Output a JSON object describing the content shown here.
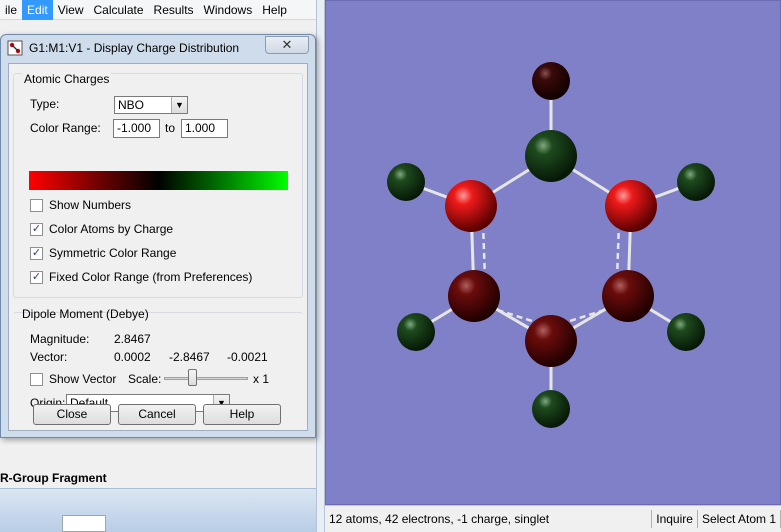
{
  "main_menu": [
    "ile",
    "Edit",
    "View",
    "Calculate",
    "Results",
    "Windows",
    "Help"
  ],
  "active_menu_index": 1,
  "left_panel": {
    "rgroup_label": "R-Group Fragment"
  },
  "dialog": {
    "title": "G1:M1:V1 - Display Charge Distribution",
    "close_glyph": "✕",
    "atomic_charges": {
      "label": "Atomic Charges",
      "type_label": "Type:",
      "type_value": "NBO",
      "color_range_label": "Color Range:",
      "range_min": "-1.000",
      "range_to": "to",
      "range_max": "1.000",
      "gradient_colors": [
        "#ff0000",
        "#000000",
        "#00ff00"
      ],
      "options": [
        {
          "label": "Show Numbers",
          "checked": false
        },
        {
          "label": "Color Atoms by Charge",
          "checked": true
        },
        {
          "label": "Symmetric Color Range",
          "checked": true
        },
        {
          "label": "Fixed Color Range (from Preferences)",
          "checked": true
        }
      ]
    },
    "dipole": {
      "label": "Dipole Moment (Debye)",
      "magnitude_label": "Magnitude:",
      "magnitude_value": "2.8467",
      "vector_label": "Vector:",
      "vector_x": "0.0002",
      "vector_y": "-2.8467",
      "vector_z": "-0.0021",
      "show_vector_label": "Show Vector",
      "scale_label": "Scale:",
      "scale_value": "x 1",
      "origin_label": "Origin:",
      "origin_value": "Default"
    },
    "buttons": {
      "close": "Close",
      "cancel": "Cancel",
      "help": "Help"
    }
  },
  "viewport": {
    "background": "#8080c8",
    "atoms": [
      {
        "role": "top-hydrogen",
        "color": "dark-red"
      },
      {
        "role": "top-ring-atom",
        "color": "dark-green"
      },
      {
        "role": "upper-left-ring-atom",
        "color": "red"
      },
      {
        "role": "upper-right-ring-atom",
        "color": "red"
      },
      {
        "role": "lower-left-ring-atom",
        "color": "dark-red"
      },
      {
        "role": "lower-right-ring-atom",
        "color": "dark-red"
      },
      {
        "role": "bottom-ring-atom",
        "color": "dark-red"
      },
      {
        "role": "left-upper-hydrogen",
        "color": "dark-green"
      },
      {
        "role": "right-upper-hydrogen",
        "color": "dark-green"
      },
      {
        "role": "left-lower-hydrogen",
        "color": "dark-green"
      },
      {
        "role": "right-lower-hydrogen",
        "color": "dark-green"
      },
      {
        "role": "bottom-hydrogen",
        "color": "dark-green"
      }
    ]
  },
  "statusbar": {
    "summary": "12 atoms, 42 electrons, -1 charge, singlet",
    "mode": "Inquire",
    "selection": "Select Atom 1"
  }
}
